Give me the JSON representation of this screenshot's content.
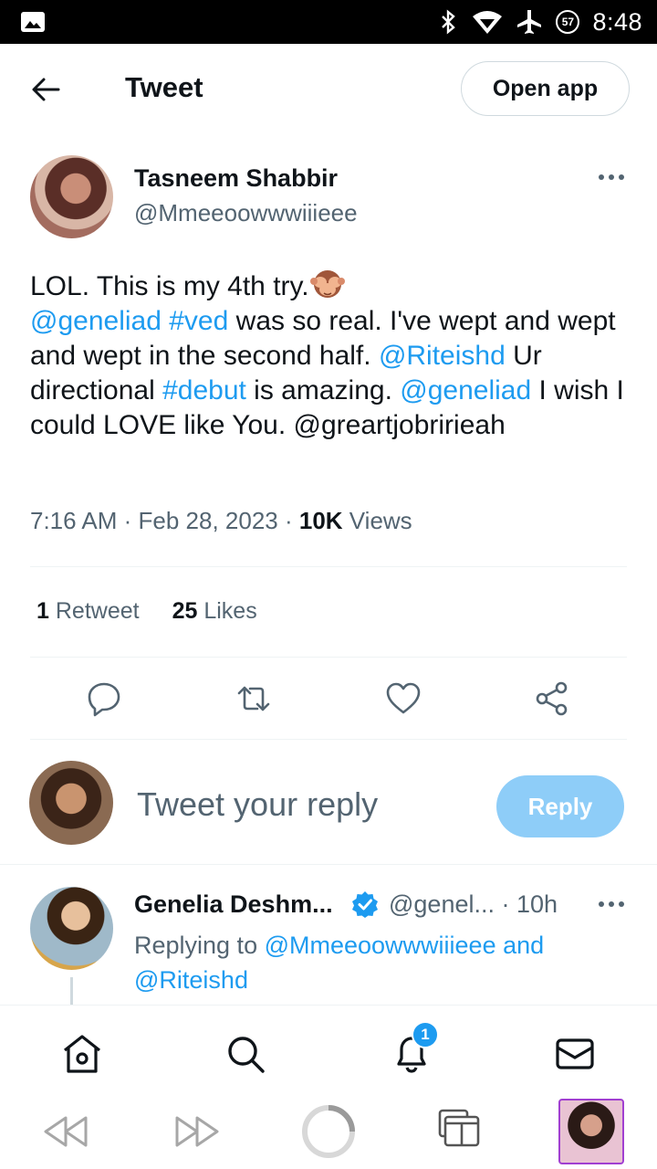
{
  "status_bar": {
    "time": "8:48",
    "battery_saver_level": "57",
    "icons": [
      "gallery-icon",
      "bluetooth-icon",
      "wifi-icon",
      "airplane-icon",
      "battery-saver-icon"
    ]
  },
  "header": {
    "title": "Tweet",
    "open_app_label": "Open app"
  },
  "tweet": {
    "author_name": "Tasneem Shabbir",
    "author_handle": "@Mmeeoowwwiiieee",
    "text_parts": {
      "p1": "LOL. This is my 4th try.",
      "m1": "@geneliad",
      "h1": "#ved",
      "p2": " was so real. I've wept and wept and wept in the second half. ",
      "m2": "@Riteishd",
      "p3": " Ur directional ",
      "h2": "#debut",
      "p4": " is amazing. ",
      "m3": "@geneliad",
      "p5": " I wish I could LOVE like You. @greartjobririeah"
    },
    "time": "7:16 AM",
    "date": "Feb 28, 2023",
    "views_count": "10K",
    "views_label": "Views",
    "retweet_count": "1",
    "retweet_label": "Retweet",
    "likes_count": "25",
    "likes_label": "Likes"
  },
  "composer": {
    "placeholder": "Tweet your reply",
    "reply_label": "Reply"
  },
  "reply": {
    "author_name": "Genelia Deshm...",
    "handle_time": "@genel... · 10h",
    "replying_prefix": "Replying to ",
    "replying_to_1": "@Mmeeoowwwiiieee",
    "replying_and": " and ",
    "replying_to_2": "@Riteishd"
  },
  "bottom_nav": {
    "notification_count": "1"
  },
  "colors": {
    "accent": "#1d9bf0",
    "reply_button": "#8ecdf8",
    "secondary_text": "#536471",
    "primary_text": "#0f1419"
  }
}
